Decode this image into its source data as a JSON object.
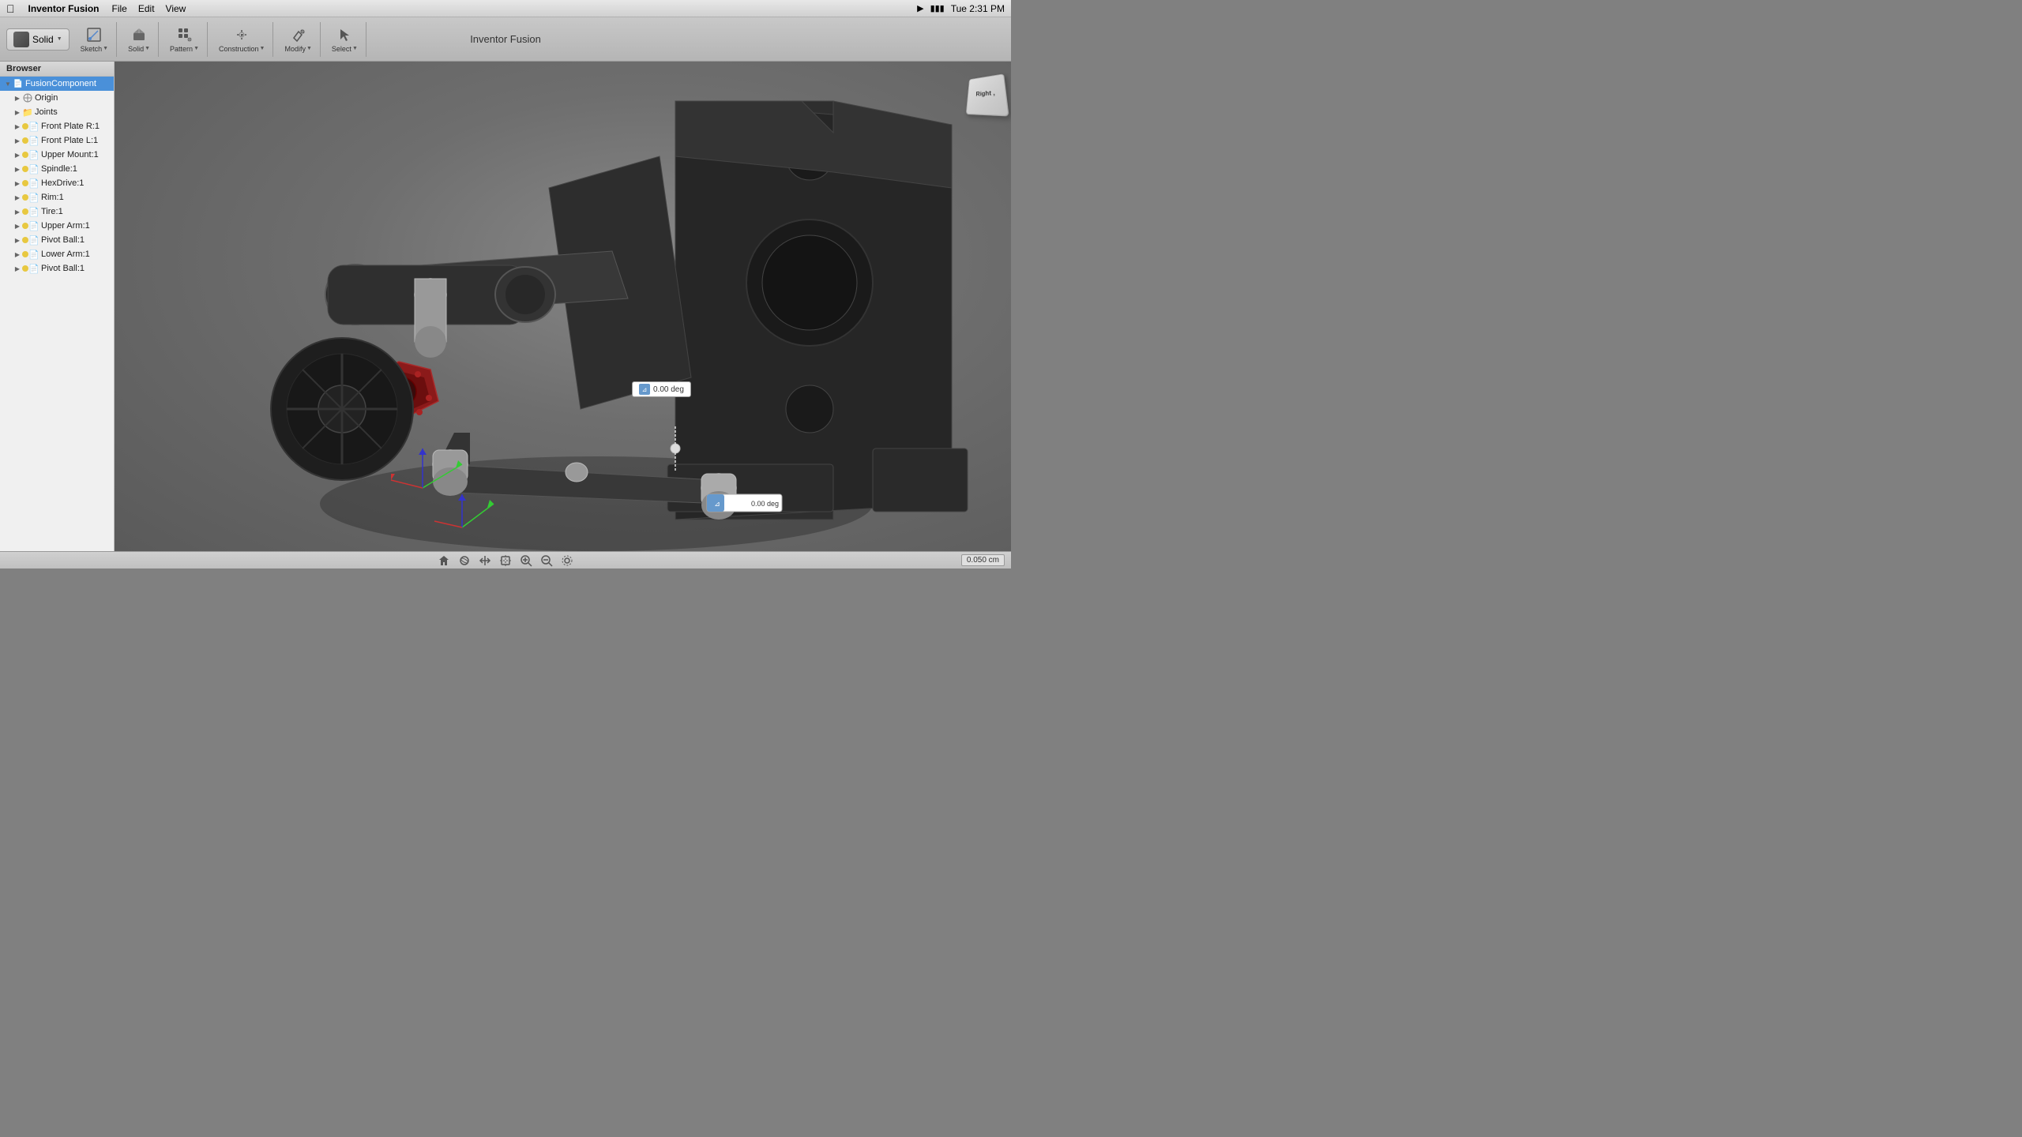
{
  "app": {
    "name": "Inventor Fusion",
    "title": "Inventor Fusion",
    "menu": [
      "Inventor Fusion",
      "File",
      "Edit",
      "View"
    ],
    "time": "Tue 2:31 PM"
  },
  "toolbar": {
    "solid_label": "Solid",
    "sketch_label": "Sketch",
    "solid_btn_label": "Solid",
    "pattern_label": "Pattern",
    "construction_label": "Construction",
    "modify_label": "Modify",
    "select_label": "Select"
  },
  "browser": {
    "title": "Browser",
    "root": "FusionComponent",
    "items": [
      {
        "id": "origin",
        "label": "Origin",
        "indent": 1,
        "type": "origin",
        "expanded": false
      },
      {
        "id": "joints",
        "label": "Joints",
        "indent": 1,
        "type": "folder",
        "expanded": false
      },
      {
        "id": "front-plate-r1",
        "label": "Front Plate R:1",
        "indent": 1,
        "type": "component",
        "expanded": false
      },
      {
        "id": "front-plate-l1",
        "label": "Front Plate L:1",
        "indent": 1,
        "type": "component",
        "expanded": false
      },
      {
        "id": "upper-mount1",
        "label": "Upper Mount:1",
        "indent": 1,
        "type": "component",
        "expanded": false
      },
      {
        "id": "spindle1",
        "label": "Spindle:1",
        "indent": 1,
        "type": "component",
        "expanded": false
      },
      {
        "id": "hexdrive1",
        "label": "HexDrive:1",
        "indent": 1,
        "type": "component",
        "expanded": false
      },
      {
        "id": "rim1",
        "label": "Rim:1",
        "indent": 1,
        "type": "component",
        "expanded": false
      },
      {
        "id": "tire1",
        "label": "Tire:1",
        "indent": 1,
        "type": "component",
        "expanded": false
      },
      {
        "id": "upper-arm1",
        "label": "Upper Arm:1",
        "indent": 1,
        "type": "component",
        "expanded": false
      },
      {
        "id": "pivot-ball1a",
        "label": "Pivot Ball:1",
        "indent": 1,
        "type": "component",
        "expanded": false
      },
      {
        "id": "lower-arm1",
        "label": "Lower Arm:1",
        "indent": 1,
        "type": "component",
        "expanded": false
      },
      {
        "id": "pivot-ball1b",
        "label": "Pivot Ball:1",
        "indent": 1,
        "type": "component",
        "expanded": false
      }
    ]
  },
  "viewport": {
    "dim_value": "0.00 deg",
    "measurement": "0.050 cm"
  },
  "viewcube": {
    "label": "Right ,"
  },
  "bottombar": {
    "icons": [
      "home",
      "orbit",
      "pan",
      "zoom-fit",
      "zoom-in",
      "zoom-out",
      "settings"
    ]
  }
}
